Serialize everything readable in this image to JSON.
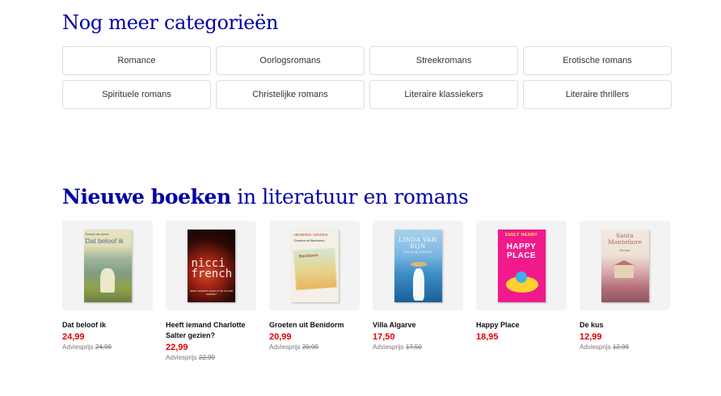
{
  "categories": {
    "heading": "Nog meer categorieën",
    "items": [
      "Romance",
      "Oorlogsromans",
      "Streekromans",
      "Erotische romans",
      "Spirituele romans",
      "Christelijke romans",
      "Literaire klassiekers",
      "Literaire thrillers"
    ]
  },
  "new_books": {
    "heading_bold": "Nieuwe boeken",
    "heading_rest": " in literatuur en romans",
    "list_price_label": "Adviesprijs ",
    "books": [
      {
        "title": "Dat beloof ik",
        "price": "24,99",
        "list_price": "24,99",
        "cover": {
          "author": "Roxane van Iperen",
          "title": "Dat beloof ik"
        }
      },
      {
        "title": "Heeft iemand Charlotte Salter gezien?",
        "price": "22,99",
        "list_price": "22,99",
        "cover": {
          "title": "nicci french",
          "subtitle": "HEEFT IEMAND CHARLOTTE SALTER GEZIEN?"
        }
      },
      {
        "title": "Groeten uit Benidorm",
        "price": "20,99",
        "list_price": "20,99",
        "cover": {
          "author": "HENDRIK GROEN",
          "title": "Groeten uit Benidorm",
          "label": "Benidorm"
        }
      },
      {
        "title": "Villa Algarve",
        "price": "17,50",
        "list_price": "17,50",
        "cover": {
          "author": "LINDA VAN RIJN",
          "title": "VILLA ALGARVE"
        }
      },
      {
        "title": "Happy Place",
        "price": "18,95",
        "list_price": "",
        "cover": {
          "author": "EMILY HENRY",
          "title": "HAPPY PLACE"
        }
      },
      {
        "title": "De kus",
        "price": "12,99",
        "list_price": "12,99",
        "cover": {
          "author": "Santa Montefiore",
          "title": "De kus"
        }
      }
    ]
  },
  "colors": {
    "accent": "#0000a4",
    "price": "#e30000",
    "border": "#dedede"
  }
}
